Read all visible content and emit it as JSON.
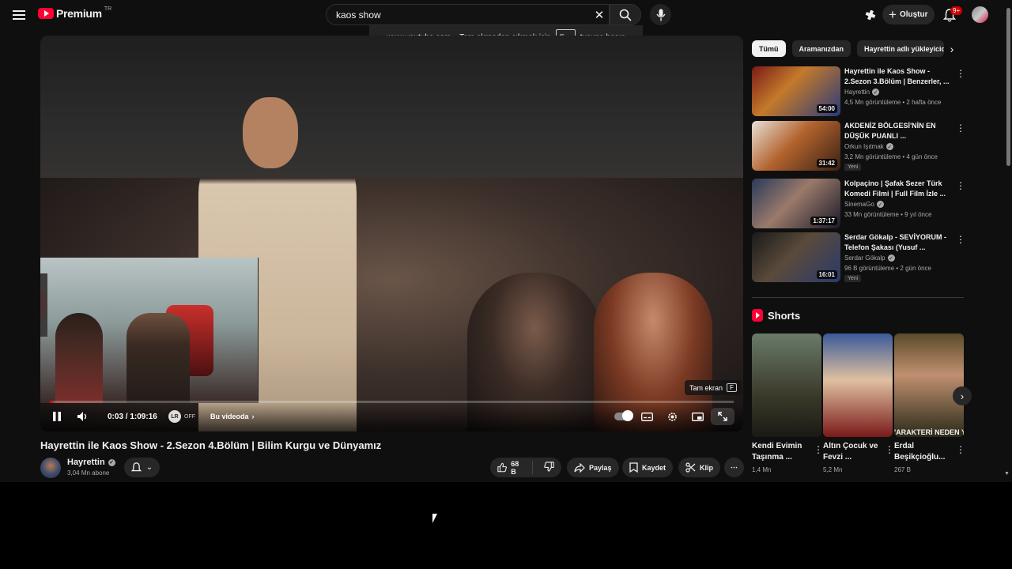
{
  "header": {
    "logo_text": "Premium",
    "country_code": "TR",
    "search_value": "kaos show",
    "create_label": "Oluştur",
    "notification_badge": "9+"
  },
  "fullscreen_hint": {
    "before": "www.youtube.com – Tam ekrandan çıkmak için",
    "key": "Esc",
    "after": "tuşuna basın"
  },
  "player": {
    "time": "0:03 / 1:09:16",
    "progress_fraction": 0.001,
    "lr_label": "LR",
    "lr_state": "OFF",
    "chapter_chip": "Bu videoda",
    "fullscreen_tooltip": "Tam ekran",
    "fullscreen_key": "F"
  },
  "video": {
    "title": "Hayrettin ile Kaos Show - 2.Sezon 4.Bölüm | Bilim Kurgu ve Dünyamız",
    "channel": "Hayrettin",
    "subscribers": "3,04 Mn abone",
    "likes": "68 B",
    "share_label": "Paylaş",
    "save_label": "Kaydet",
    "clip_label": "Klip"
  },
  "filters": [
    "Tümü",
    "Aramanızdan",
    "Hayrettin adlı yükleyicid"
  ],
  "recommendations": [
    {
      "title": "Hayrettin ile Kaos Show - 2.Sezon 3.Bölüm | Benzerler, ...",
      "channel": "Hayrettin",
      "meta": "4,5 Mn görüntüleme • 2 hafta önce",
      "duration": "54:00",
      "new": ""
    },
    {
      "title": "AKDENİZ BÖLGESİ'NİN EN DÜŞÜK PUANLI ...",
      "channel": "Orkun Işıtmak",
      "meta": "3,2 Mn görüntüleme • 4 gün önce",
      "duration": "31:42",
      "new": "Yeni"
    },
    {
      "title": "Kolpaçino | Şafak Sezer Türk Komedi Filmi | Full Film İzle ...",
      "channel": "SinemaGo",
      "meta": "33 Mn görüntüleme • 9 yıl önce",
      "duration": "1:37:17",
      "new": ""
    },
    {
      "title": "Serdar Gökalp - SEVİYORUM - Telefon Şakası (Yusuf ...",
      "channel": "Serdar Gökalp",
      "meta": "96 B görüntüleme • 2 gün önce",
      "duration": "16:01",
      "new": "Yeni"
    }
  ],
  "shorts": {
    "heading": "Shorts",
    "items": [
      {
        "title": "Kendi Evimin Taşınma ...",
        "views": "1,4 Mn"
      },
      {
        "title": "Altın Çocuk ve Fevzi ...",
        "views": "5,2 Mn"
      },
      {
        "title": "Erdal Beşikçioğlu...",
        "views": "267 B",
        "overlay": "'ARAKTERİ NEDEN Y"
      }
    ]
  },
  "colors": {
    "accent": "#ff0033",
    "background": "#0f0f0f",
    "chip": "#272727"
  }
}
